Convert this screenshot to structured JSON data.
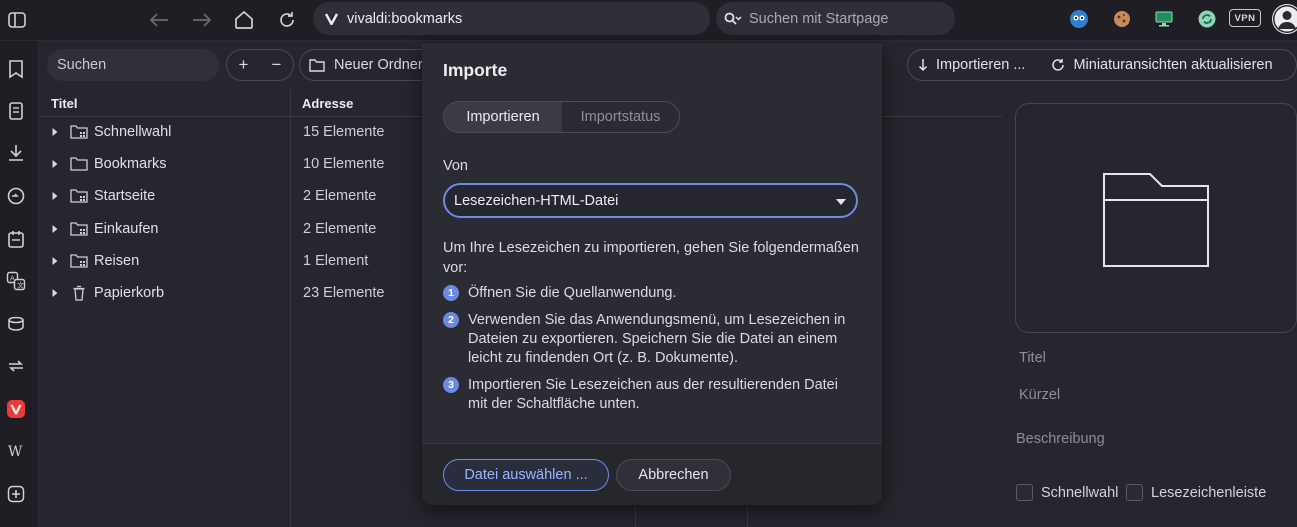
{
  "address_bar": {
    "url": "vivaldi:bookmarks"
  },
  "search_bar": {
    "placeholder": "Suchen mit Startpage"
  },
  "extensions": {
    "vpn_label": "VPN"
  },
  "toolbar": {
    "search_placeholder": "Suchen",
    "add_label": "+",
    "remove_label": "−",
    "new_folder_label": "Neuer Ordner",
    "import_label": "Importieren ...",
    "refresh_thumbnails_label": "Miniaturansichten aktualisieren"
  },
  "table": {
    "columns": [
      "Titel",
      "Adresse"
    ],
    "rows": [
      {
        "title": "Schnellwahl",
        "address": "15 Elemente",
        "icon": "speed-dial-folder-icon"
      },
      {
        "title": "Bookmarks",
        "address": "10 Elemente",
        "icon": "folder-icon"
      },
      {
        "title": "Startseite",
        "address": "2 Elemente",
        "icon": "speed-dial-folder-icon"
      },
      {
        "title": "Einkaufen",
        "address": "2 Elemente",
        "icon": "speed-dial-folder-icon"
      },
      {
        "title": "Reisen",
        "address": "1 Element",
        "icon": "speed-dial-folder-icon"
      },
      {
        "title": "Papierkorb",
        "address": "23 Elemente",
        "icon": "trash-icon"
      }
    ]
  },
  "details": {
    "title_label": "Titel",
    "nickname_label": "Kürzel",
    "description_label": "Beschreibung",
    "speed_dial_label": "Schnellwahl",
    "bookmark_bar_label": "Lesezeichenleiste"
  },
  "dialog": {
    "title": "Importe",
    "tabs": [
      "Importieren",
      "Importstatus"
    ],
    "from_label": "Von",
    "source_value": "Lesezeichen-HTML-Datei",
    "intro": "Um Ihre Lesezeichen zu importieren, gehen Sie folgendermaßen vor:",
    "steps": [
      {
        "num": "1",
        "text": "Öffnen Sie die Quellanwendung."
      },
      {
        "num": "2",
        "text": "Verwenden Sie das Anwendungsmenü, um Lesezeichen in Dateien zu exportieren. Speichern Sie die Datei an einem leicht zu findenden Ort (z. B. Dokumente)."
      },
      {
        "num": "3",
        "text": "Importieren Sie Lesezeichen aus der resultierenden Datei mit der Schaltfläche unten."
      }
    ],
    "choose_file_label": "Datei auswählen ...",
    "cancel_label": "Abbrechen"
  },
  "colors": {
    "accent": "#6f8be6",
    "background": "#26262e",
    "chrome": "#1e1e24"
  }
}
